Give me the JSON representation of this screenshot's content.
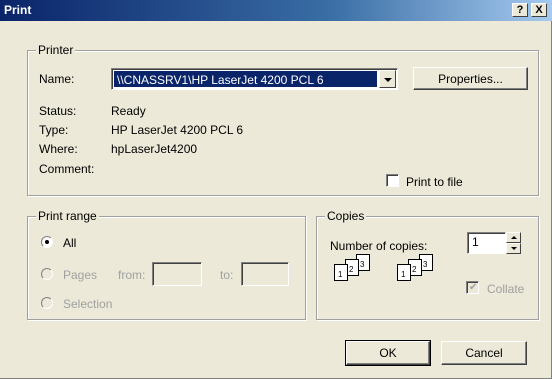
{
  "window": {
    "title": "Print",
    "help_label": "?",
    "close_label": "X"
  },
  "printer": {
    "group_label": "Printer",
    "name_label": "Name:",
    "name_value": "\\\\CNASSRV1\\HP LaserJet 4200 PCL 6",
    "properties_label": "Properties...",
    "status_label": "Status:",
    "status_value": "Ready",
    "type_label": "Type:",
    "type_value": "HP LaserJet 4200 PCL 6",
    "where_label": "Where:",
    "where_value": "hpLaserJet4200",
    "comment_label": "Comment:",
    "print_to_file_label": "Print to file",
    "print_to_file_checked": false
  },
  "print_range": {
    "group_label": "Print range",
    "all_label": "All",
    "pages_label": "Pages",
    "from_label": "from:",
    "to_label": "to:",
    "from_value": "",
    "to_value": "",
    "selection_label": "Selection",
    "selected": "All"
  },
  "copies": {
    "group_label": "Copies",
    "number_label": "Number of copies:",
    "number_value": "1",
    "collate_label": "Collate",
    "collate_checked": true,
    "collate_enabled": false,
    "page_numbers": [
      "1",
      "2",
      "3"
    ]
  },
  "buttons": {
    "ok_label": "OK",
    "cancel_label": "Cancel"
  },
  "icons": [
    "help-icon",
    "close-icon",
    "dropdown-arrow-icon",
    "spin-up-icon",
    "spin-down-icon",
    "collate-pages-icon"
  ]
}
